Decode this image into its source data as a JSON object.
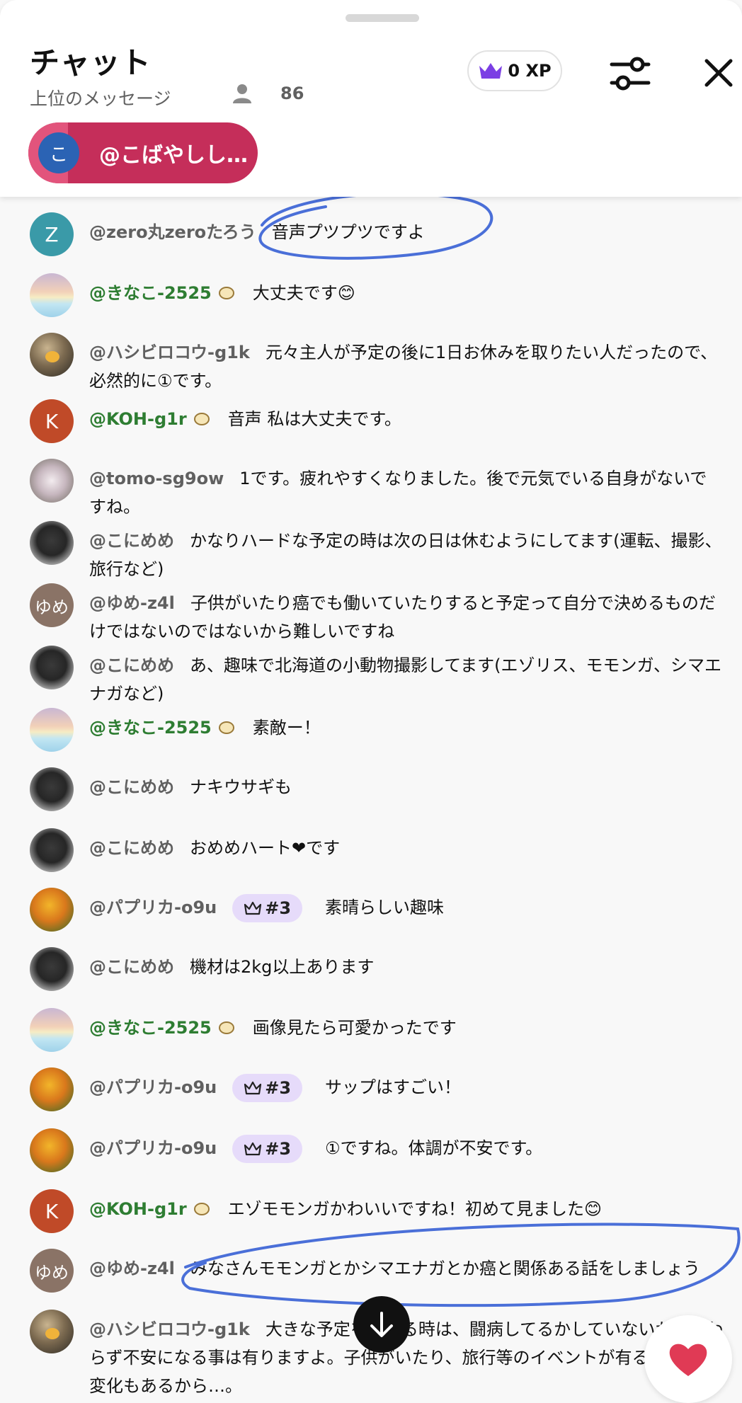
{
  "header": {
    "title": "チャット",
    "subtitle": "上位のメッセージ",
    "viewer_count": "86",
    "xp": "0 XP",
    "pinned_avatar_letter": "こ",
    "pinned_name": "@こばやしし…"
  },
  "colors": {
    "pinned_bg": "#c52e5a",
    "rank_bg": "#e6dbfa",
    "annotation": "#4a6fd8",
    "heart": "#e03a55"
  },
  "messages": [
    {
      "avatar": "Z",
      "author": "@zero丸zeroたろう",
      "text": "音声プツプツですよ"
    },
    {
      "author": "@きなこ-2525",
      "text": "大丈夫です😊"
    },
    {
      "author": "@ハシビロコウ-g1k",
      "text": "元々主人が予定の後に1日お休みを取りたい人だったので、必然的に①です。"
    },
    {
      "avatar": "K",
      "author": "@KOH-g1r",
      "text": "音声 私は大丈夫です。"
    },
    {
      "author": "@tomo-sg9ow",
      "text": "1です。疲れやすくなりました。後で元気でいる自身がないですね。"
    },
    {
      "author": "@こにめめ",
      "text": "かなりハードな予定の時は次の日は休むようにしてます(運転、撮影、旅行など)"
    },
    {
      "avatar": "ゆめ",
      "author": "@ゆめ-z4l",
      "text": "子供がいたり癌でも働いていたりすると予定って自分で決めるものだけではないのではないから難しいですね"
    },
    {
      "author": "@こにめめ",
      "text": "あ、趣味で北海道の小動物撮影してます(エゾリス、モモンガ、シマエナガなど)"
    },
    {
      "author": "@きなこ-2525",
      "text": "素敵ー！"
    },
    {
      "author": "@こにめめ",
      "text": "ナキウサギも"
    },
    {
      "author": "@こにめめ",
      "text": "おめめハート❤です"
    },
    {
      "author": "@パプリカ-o9u",
      "rank": "#3",
      "text": "素晴らしい趣味"
    },
    {
      "author": "@こにめめ",
      "text": "機材は2kg以上あります"
    },
    {
      "author": "@きなこ-2525",
      "text": "画像見たら可愛かったです"
    },
    {
      "author": "@パプリカ-o9u",
      "rank": "#3",
      "text": "サップはすごい！"
    },
    {
      "author": "@パプリカ-o9u",
      "rank": "#3",
      "text": "①ですね。体調が不安です。"
    },
    {
      "avatar": "K",
      "author": "@KOH-g1r",
      "text": "エゾモモンガかわいいですね！初めて見ました😊"
    },
    {
      "avatar": "ゆめ",
      "author": "@ゆめ-z4l",
      "text": "みなさんモモンガとかシマエナガとか癌と関係ある話をしましょう"
    },
    {
      "author": "@ハシビロコウ-g1k",
      "text": "大きな予定を立てる時は、闘病してるかしていないかに関わらず不安になる事は有りますよ。子供がいたり、旅行等のイベントが有ると体調の変化もあるから…。"
    }
  ]
}
